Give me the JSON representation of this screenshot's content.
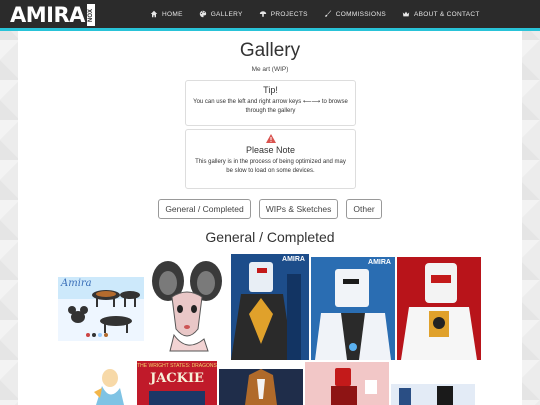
{
  "brand": {
    "main": "AMIRA",
    "sub": "NOX"
  },
  "nav": [
    {
      "label": "HOME",
      "icon": "home-icon"
    },
    {
      "label": "GALLERY",
      "icon": "palette-icon"
    },
    {
      "label": "PROJECTS",
      "icon": "mushroom-icon"
    },
    {
      "label": "COMMISSIONS",
      "icon": "brush-icon"
    },
    {
      "label": "ABOUT & CONTACT",
      "icon": "crown-icon"
    }
  ],
  "page": {
    "title": "Gallery",
    "subtitle": "Me art (WIP)"
  },
  "tip": {
    "heading": "Tip!",
    "text": "You can use the left and right arrow keys ⟵⟶ to browse through the gallery"
  },
  "note": {
    "heading": "Please Note",
    "text": "This gallery is in the process of being optimized and may be slow to load on some devices."
  },
  "tabs": [
    "General / Completed",
    "WIPs & Sketches",
    "Other"
  ],
  "section": {
    "title": "General / Completed"
  },
  "thumbs": [
    {
      "name": "thumb-amira-ref-sheet",
      "caption": "Amira"
    },
    {
      "name": "thumb-mouse-portrait"
    },
    {
      "name": "thumb-robot-blue-1",
      "caption": "AMIRA"
    },
    {
      "name": "thumb-robot-blue-2",
      "caption": "AMIRA"
    },
    {
      "name": "thumb-robot-red"
    },
    {
      "name": "thumb-fish-character"
    },
    {
      "name": "thumb-jackie-poster",
      "caption": "JACKIE",
      "caption2": "THE WRIGHT STATES: DRAGONS"
    },
    {
      "name": "thumb-sheltie-dog"
    },
    {
      "name": "thumb-red-robot-scene"
    },
    {
      "name": "thumb-blue-scene"
    }
  ],
  "colors": {
    "accent": "#29c3d8",
    "nav_bg": "#2b2b2b",
    "robot_red": "#c31a1a",
    "robot_blue": "#1f5f9c"
  }
}
